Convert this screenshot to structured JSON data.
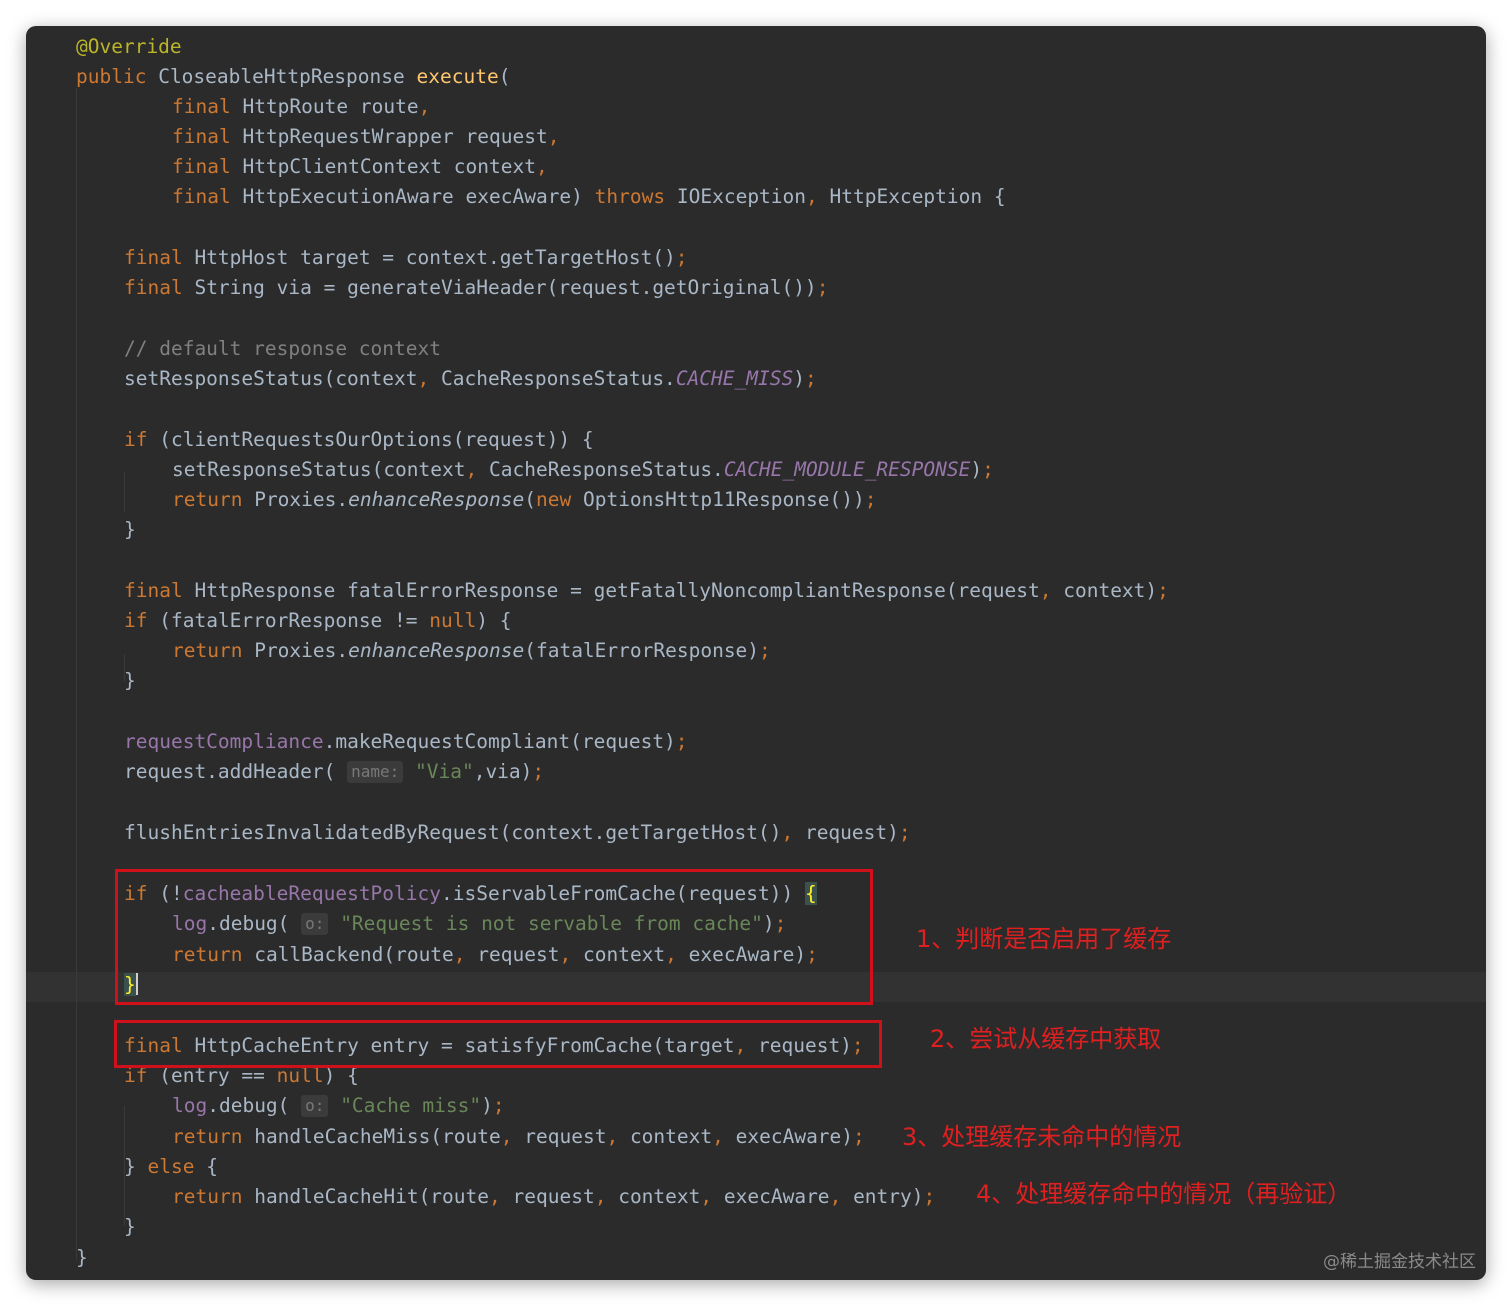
{
  "code": {
    "l1": {
      "ann": "@Override"
    },
    "l2": {
      "kw": "public",
      "type": "CloseableHttpResponse",
      "fn": "execute",
      "paren": "("
    },
    "l3": {
      "kw": "final",
      "rest": "HttpRoute route",
      "punct": ","
    },
    "l4": {
      "kw": "final",
      "rest": "HttpRequestWrapper request",
      "punct": ","
    },
    "l5": {
      "kw": "final",
      "rest": "HttpClientContext context",
      "punct": ","
    },
    "l6": {
      "kw": "final",
      "rest": "HttpExecutionAware execAware)",
      "kw2": "throws",
      "rest2": "IOException",
      "punct": ",",
      "rest3": "HttpException {"
    },
    "l8": {
      "kw": "final",
      "rest": "HttpHost target = context.getTargetHost()",
      "semi": ";"
    },
    "l9": {
      "kw": "final",
      "rest": "String via = generateViaHeader(request.getOriginal())",
      "semi": ";"
    },
    "l11": {
      "comment": "// default response context"
    },
    "l12": {
      "a": "setResponseStatus(context",
      "punct": ",",
      "b": "CacheResponseStatus.",
      "const": "CACHE_MISS",
      "c": ")",
      "semi": ";"
    },
    "l14": {
      "kw": "if",
      "rest": "(clientRequestsOurOptions(request)) {"
    },
    "l15": {
      "a": "setResponseStatus(context",
      "punct": ",",
      "b": "CacheResponseStatus.",
      "const": "CACHE_MODULE_RESPONSE",
      "c": ")",
      "semi": ";"
    },
    "l16": {
      "kw": "return",
      "a": "Proxies.",
      "fn": "enhanceResponse",
      "b": "(",
      "kw2": "new",
      "c": "OptionsHttp11Response())",
      "semi": ";"
    },
    "l17": {
      "brace": "}"
    },
    "l19": {
      "kw": "final",
      "a": "HttpResponse fatalErrorResponse = getFatallyNoncompliantResponse(request",
      "punct": ",",
      "b": "context)",
      "semi": ";"
    },
    "l20": {
      "kw": "if",
      "a": "(fatalErrorResponse != ",
      "kw2": "null",
      "b": ") {"
    },
    "l21": {
      "kw": "return",
      "a": "Proxies.",
      "fn": "enhanceResponse",
      "b": "(fatalErrorResponse)",
      "semi": ";"
    },
    "l22": {
      "brace": "}"
    },
    "l24": {
      "field": "requestCompliance",
      "a": ".makeRequestCompliant(request)",
      "semi": ";"
    },
    "l25": {
      "a": "request.addHeader(",
      "hint": "name:",
      "str": "\"Via\"",
      "b": ",via)",
      "semi": ";"
    },
    "l27": {
      "a": "flushEntriesInvalidatedByRequest(context.getTargetHost()",
      "punct": ",",
      "b": "request)",
      "semi": ";"
    },
    "l29": {
      "kw": "if",
      "a": "(!",
      "field": "cacheableRequestPolicy",
      "b": ".isServableFromCache(request))",
      "brace": "{"
    },
    "l30": {
      "field": "log",
      "a": ".debug(",
      "hint": "o:",
      "str": "\"Request is not servable from cache\"",
      "b": ")",
      "semi": ";"
    },
    "l31": {
      "kw": "return",
      "a": "callBackend(route",
      "p1": ",",
      "b": "request",
      "p2": ",",
      "c": "context",
      "p3": ",",
      "d": "execAware)",
      "semi": ";"
    },
    "l32": {
      "brace": "}"
    },
    "l34": {
      "kw": "final",
      "a": "HttpCacheEntry entry = satisfyFromCache(target",
      "punct": ",",
      "b": "request)",
      "semi": ";"
    },
    "l35": {
      "kw": "if",
      "a": "(entry == ",
      "kw2": "null",
      "b": ") {"
    },
    "l36": {
      "field": "log",
      "a": ".debug(",
      "hint": "o:",
      "str": "\"Cache miss\"",
      "b": ")",
      "semi": ";"
    },
    "l37": {
      "kw": "return",
      "a": "handleCacheMiss(route",
      "p1": ",",
      "b": "request",
      "p2": ",",
      "c": "context",
      "p3": ",",
      "d": "execAware)",
      "semi": ";"
    },
    "l38": {
      "a": "} ",
      "kw": "else",
      "b": " {"
    },
    "l39": {
      "kw": "return",
      "a": "handleCacheHit(route",
      "p1": ",",
      "b": "request",
      "p2": ",",
      "c": "context",
      "p3": ",",
      "d": "execAware",
      "p4": ",",
      "e": "entry)",
      "semi": ";"
    },
    "l40": {
      "brace": "}"
    },
    "l41": {
      "brace": "}"
    }
  },
  "annotations": {
    "note1": "1、判断是否启用了缓存",
    "note2": "2、尝试从缓存中获取",
    "note3": "3、处理缓存未命中的情况",
    "note4": "4、处理缓存命中的情况（再验证）"
  },
  "watermark": "@稀土掘金技术社区",
  "colors": {
    "editor_bg": "#2b2b2b",
    "keyword": "#cc7832",
    "annotation": "#bbb529",
    "method_decl": "#ffc66d",
    "string": "#6a8759",
    "field": "#9876aa",
    "comment": "#808080",
    "text": "#a9b7c6",
    "highlight_box": "#d0101b"
  }
}
